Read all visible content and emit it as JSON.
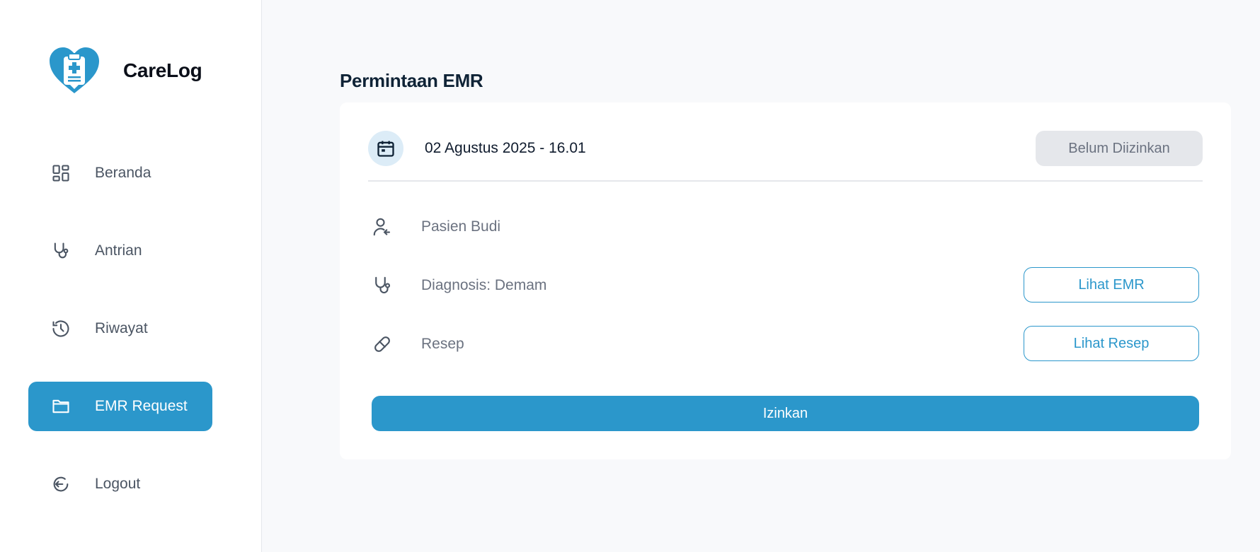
{
  "app": {
    "name": "CareLog"
  },
  "sidebar": {
    "items": [
      {
        "label": "Beranda",
        "icon": "dashboard-icon"
      },
      {
        "label": "Antrian",
        "icon": "stethoscope-icon"
      },
      {
        "label": "Riwayat",
        "icon": "history-icon"
      },
      {
        "label": "EMR Request",
        "icon": "folder-icon",
        "active": true
      },
      {
        "label": "Logout",
        "icon": "logout-icon"
      }
    ]
  },
  "main": {
    "title": "Permintaan EMR",
    "request": {
      "datetime": "02 Agustus 2025 - 16.01",
      "status": "Belum Diizinkan",
      "patient": "Pasien Budi",
      "diagnosis": "Diagnosis: Demam",
      "prescription": "Resep",
      "view_emr_label": "Lihat EMR",
      "view_prescription_label": "Lihat Resep",
      "approve_label": "Izinkan"
    }
  },
  "colors": {
    "accent": "#2b97cb",
    "status_badge_bg": "#e5e7eb",
    "background": "#f8f9fb"
  }
}
